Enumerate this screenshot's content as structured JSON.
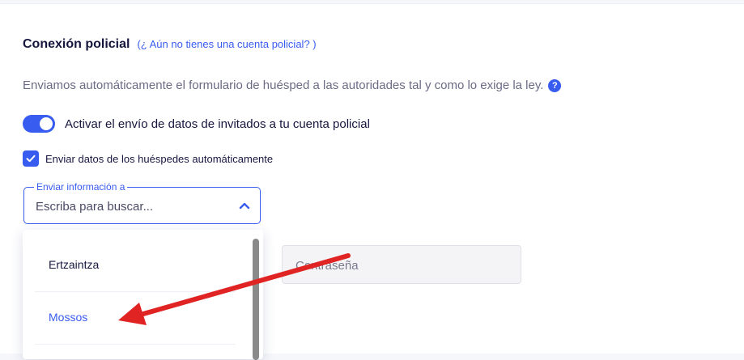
{
  "section": {
    "title": "Conexión policial",
    "account_link": "(¿ Aún no tienes una cuenta policial? )"
  },
  "description": "Enviamos automáticamente el formulario de huésped a las autoridades tal y como lo exige la ley.",
  "help_icon": {
    "icon": "question-mark-icon",
    "glyph": "?"
  },
  "toggle": {
    "label": "Activar el envío de datos de invitados a tu cuenta policial",
    "state": "on"
  },
  "checkbox": {
    "label": "Enviar datos de los huéspedes automáticamente",
    "checked": true
  },
  "select": {
    "legend": "Enviar información a",
    "placeholder": "Escriba para buscar...",
    "state": "open",
    "options": [
      {
        "label": "Ertzaintza",
        "highlighted": false
      },
      {
        "label": "Mossos",
        "highlighted": true
      }
    ]
  },
  "password": {
    "placeholder": "Contraseña"
  },
  "colors": {
    "accent": "#385cf0",
    "text": "#16163f",
    "annotation_arrow": "#e02424"
  }
}
